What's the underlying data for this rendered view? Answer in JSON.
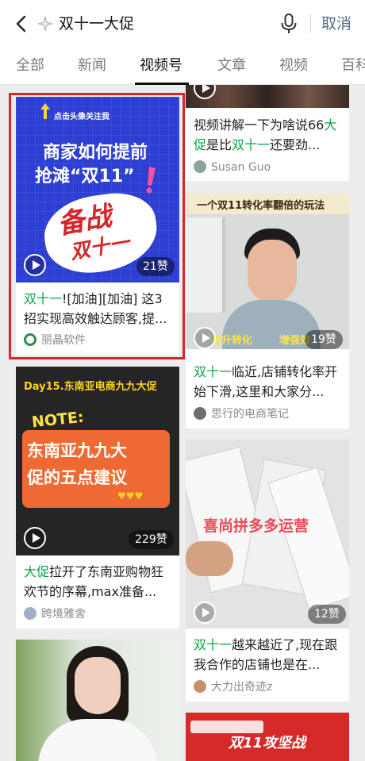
{
  "search": {
    "query": "双十一大促",
    "cancel_label": "取消"
  },
  "tabs": [
    "全部",
    "新闻",
    "视频号",
    "文章",
    "视频",
    "百科"
  ],
  "colors": {
    "accent_green": "#07a647",
    "link_blue": "#576b95",
    "selection_red": "#d9252b"
  },
  "cards": [
    {
      "title_parts": [
        {
          "t": "双十一",
          "hl": true
        },
        {
          "t": "![加油][加油] 这3招实现高效触达顾客,提...",
          "hl": false
        }
      ],
      "author": "丽晶软件",
      "likes": "21赞",
      "overlay": {
        "top": "点击头像关注我",
        "line1": "商家如何提前",
        "line2": "抢滩“双11”",
        "script1": "备战",
        "script2": "双十一"
      }
    },
    {
      "title_parts": [
        {
          "t": "视频讲解一下为啥说66",
          "hl": false
        },
        {
          "t": "大促",
          "hl": true
        },
        {
          "t": "是比",
          "hl": false
        },
        {
          "t": "双十一",
          "hl": true
        },
        {
          "t": "还要劲...",
          "hl": false
        }
      ],
      "author": "Susan Guo"
    },
    {
      "title_parts": [
        {
          "t": "双十一",
          "hl": true
        },
        {
          "t": "临近,店铺转化率开始下滑,这里和大家分...",
          "hl": false
        }
      ],
      "author": "思行的电商笔记",
      "likes": "19赞",
      "overlay": {
        "top": "一个双11转化率翻倍的玩法",
        "left": "提升转化",
        "right": "增强效"
      }
    },
    {
      "title_parts": [
        {
          "t": "大促",
          "hl": true
        },
        {
          "t": "拉开了东南亚购物狂欢节的序幕,max准备...",
          "hl": false
        }
      ],
      "author": "跨境雅舍",
      "likes": "229赞",
      "overlay": {
        "top": "Day15.东南亚电商九九大促",
        "note": "NOTE:",
        "line1": "东南亚九九大",
        "line2": "促的五点建议"
      }
    },
    {
      "title_parts": [
        {
          "t": "双十一",
          "hl": true
        },
        {
          "t": "越来越近了,现在跟我合作的店铺也是在...",
          "hl": false
        }
      ],
      "author": "大力出奇迹z",
      "likes": "12赞",
      "overlay": {
        "mid": "喜尚拼多多运营"
      }
    },
    {
      "overlay": {
        "line1": "双11攻坚战"
      }
    }
  ]
}
